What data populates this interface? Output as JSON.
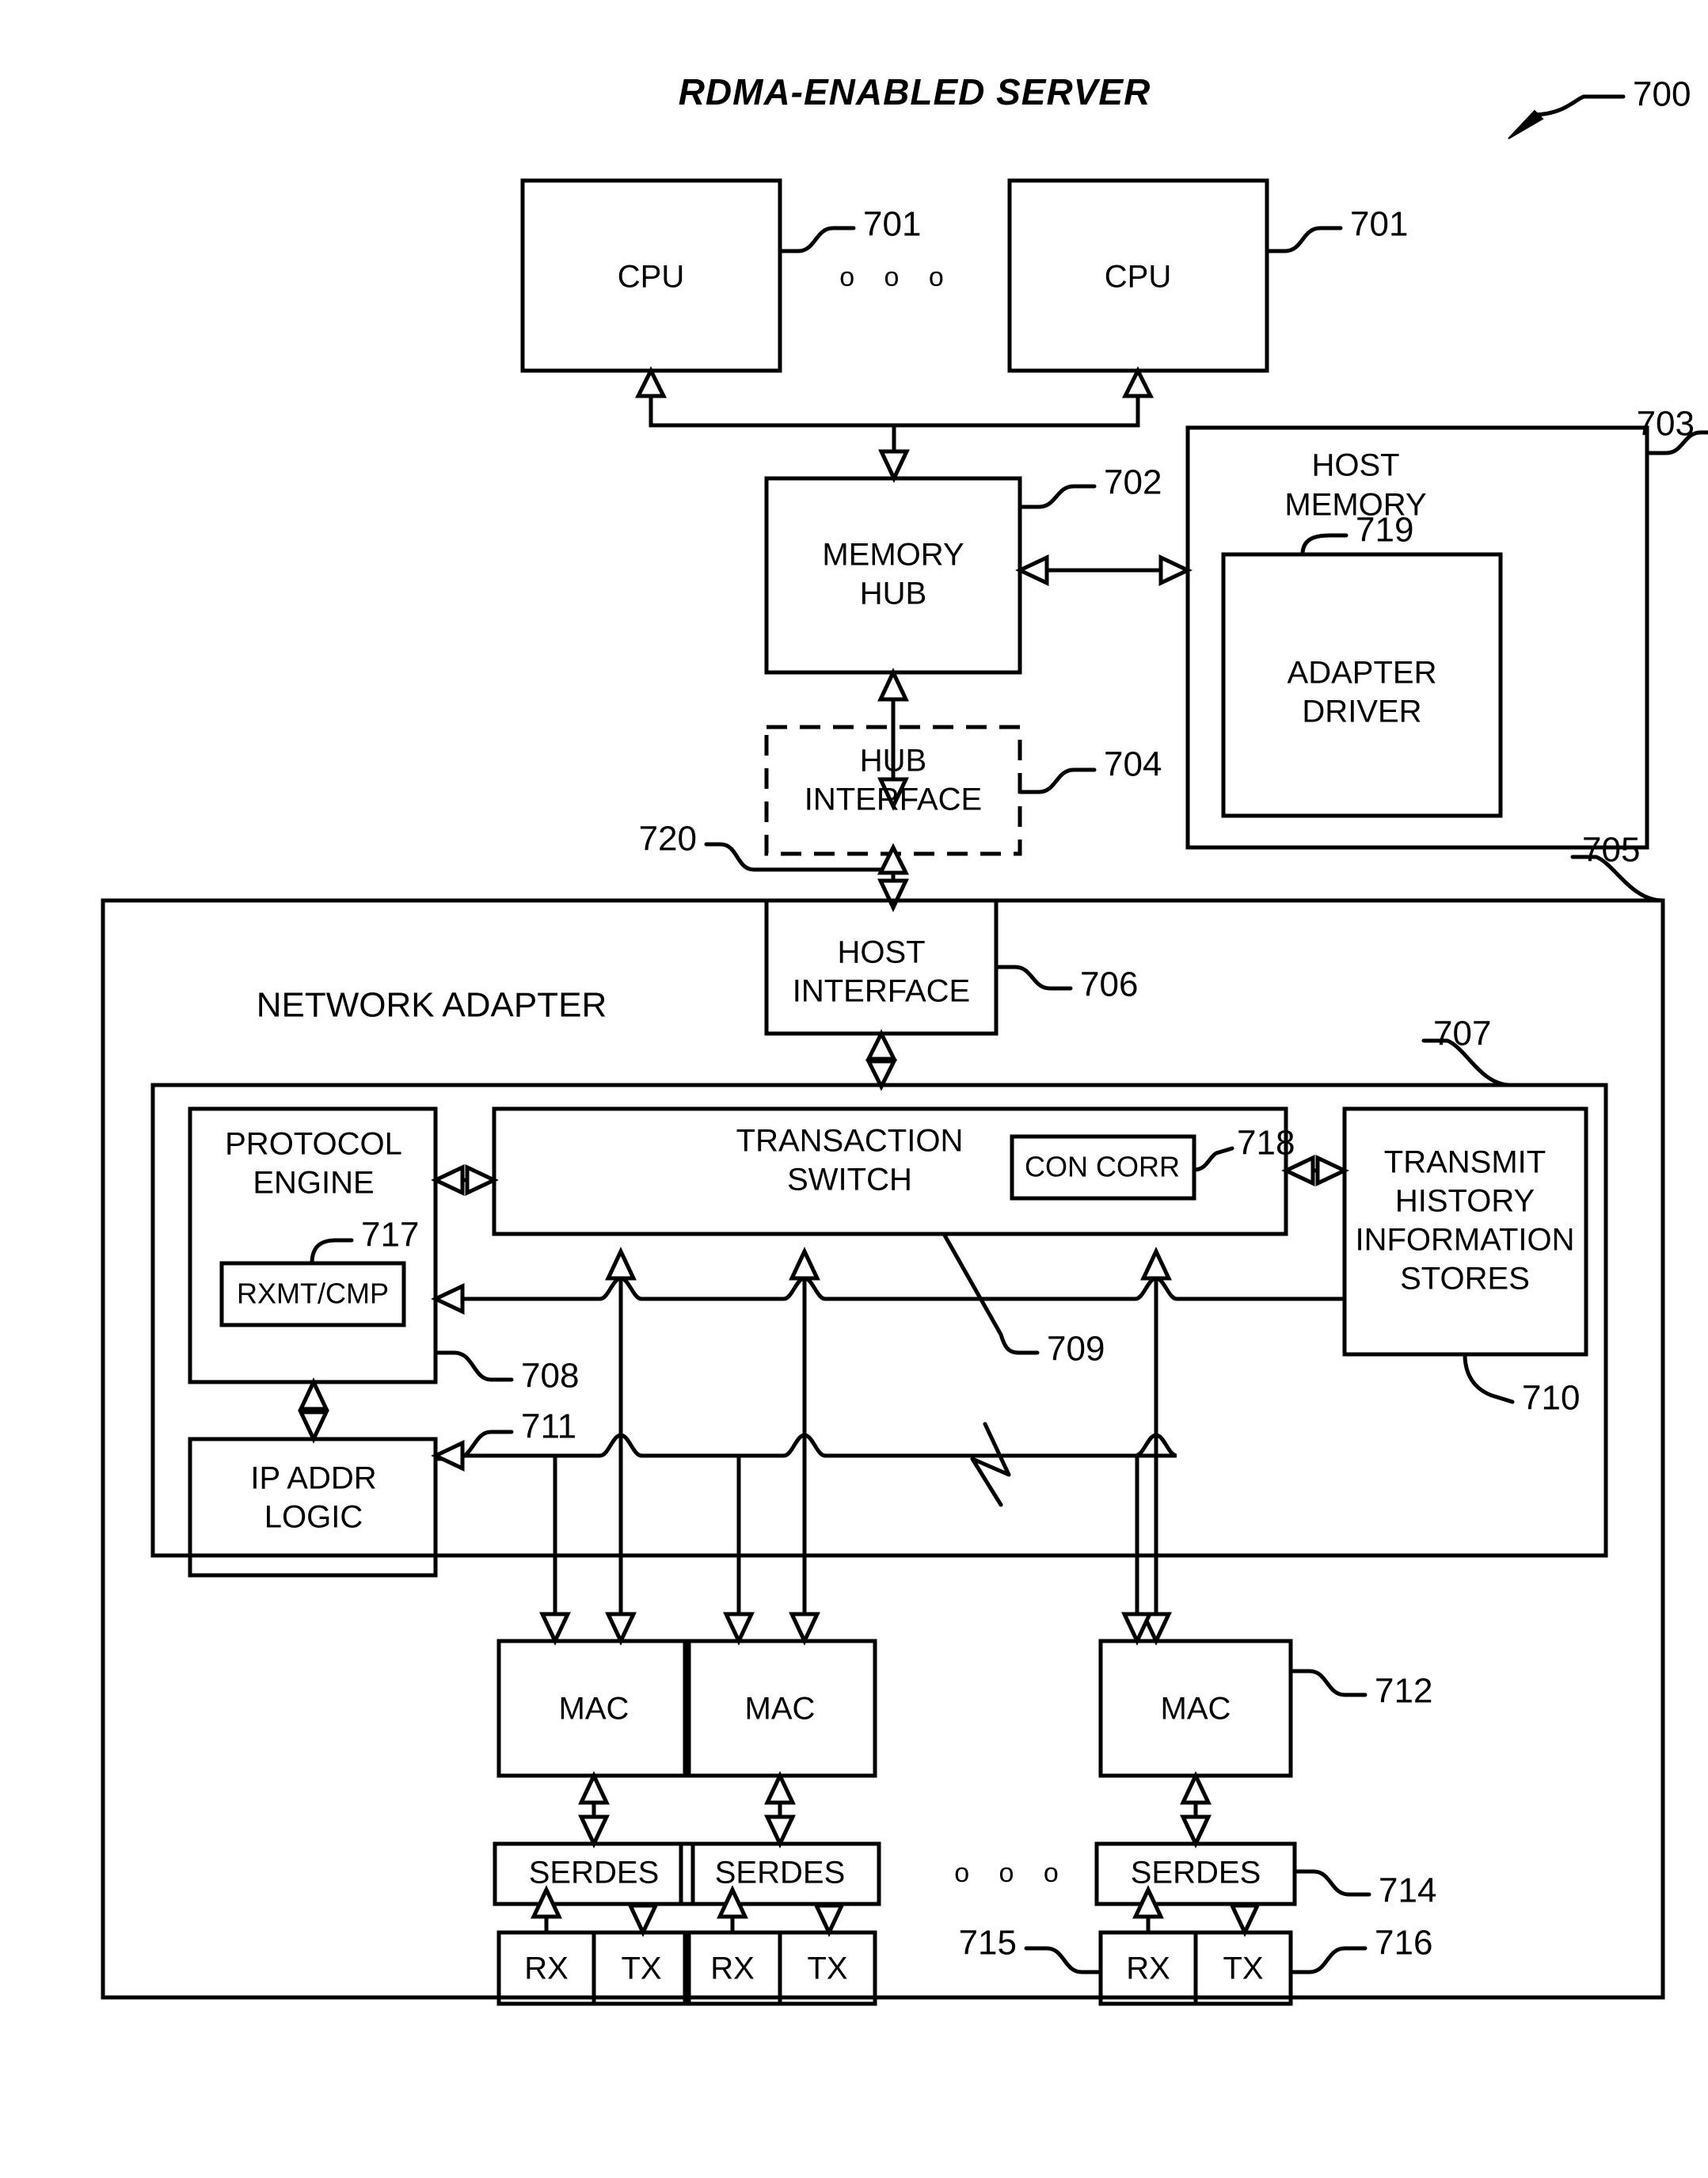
{
  "figure": {
    "title": "RDMA-ENABLED SERVER",
    "figure_ref": "700"
  },
  "blocks": {
    "cpu_left": {
      "label": "CPU",
      "ref": "701"
    },
    "cpu_right": {
      "label": "CPU",
      "ref": "701"
    },
    "cpu_ellipsis": "o o o",
    "memory_hub": {
      "line1": "MEMORY",
      "line2": "HUB",
      "ref": "702"
    },
    "host_memory": {
      "line1": "HOST",
      "line2": "MEMORY",
      "ref": "703"
    },
    "adapter_driver": {
      "line1": "ADAPTER",
      "line2": "DRIVER",
      "ref": "719"
    },
    "hub_interface": {
      "line1": "HUB",
      "line2": "INTERFACE",
      "ref": "704"
    },
    "hub_link": {
      "ref": "720"
    },
    "network_adapter": {
      "label": "NETWORK ADAPTER",
      "ref": "705"
    },
    "host_interface": {
      "line1": "HOST",
      "line2": "INTERFACE",
      "ref": "706"
    },
    "inner_module": {
      "ref": "707"
    },
    "protocol_engine": {
      "line1": "PROTOCOL",
      "line2": "ENGINE",
      "ref": "708"
    },
    "rxmt_cmp": {
      "label": "RXMT/CMP",
      "ref": "717"
    },
    "ip_addr_logic": {
      "line1": "IP ADDR",
      "line2": "LOGIC",
      "ref": "711"
    },
    "transaction_switch": {
      "line1": "TRANSACTION",
      "line2": "SWITCH",
      "ref": "709"
    },
    "con_corr": {
      "label": "CON CORR",
      "ref": "718"
    },
    "transmit_history": {
      "line1": "TRANSMIT",
      "line2": "HISTORY",
      "line3": "INFORMATION",
      "line4": "STORES",
      "ref": "710"
    },
    "mac_1": {
      "label": "MAC"
    },
    "mac_2": {
      "label": "MAC"
    },
    "mac_3": {
      "label": "MAC",
      "ref": "712"
    },
    "serdes_1": {
      "label": "SERDES"
    },
    "serdes_2": {
      "label": "SERDES"
    },
    "serdes_3": {
      "label": "SERDES",
      "ref": "714"
    },
    "serdes_ellipsis": "o o o",
    "rx_1": {
      "label": "RX"
    },
    "tx_1": {
      "label": "TX"
    },
    "rx_2": {
      "label": "RX"
    },
    "tx_2": {
      "label": "TX"
    },
    "rx_3": {
      "label": "RX",
      "ref": "715"
    },
    "tx_3": {
      "label": "TX",
      "ref": "716"
    }
  },
  "colors": {
    "stroke": "#000000",
    "background": "#ffffff"
  }
}
